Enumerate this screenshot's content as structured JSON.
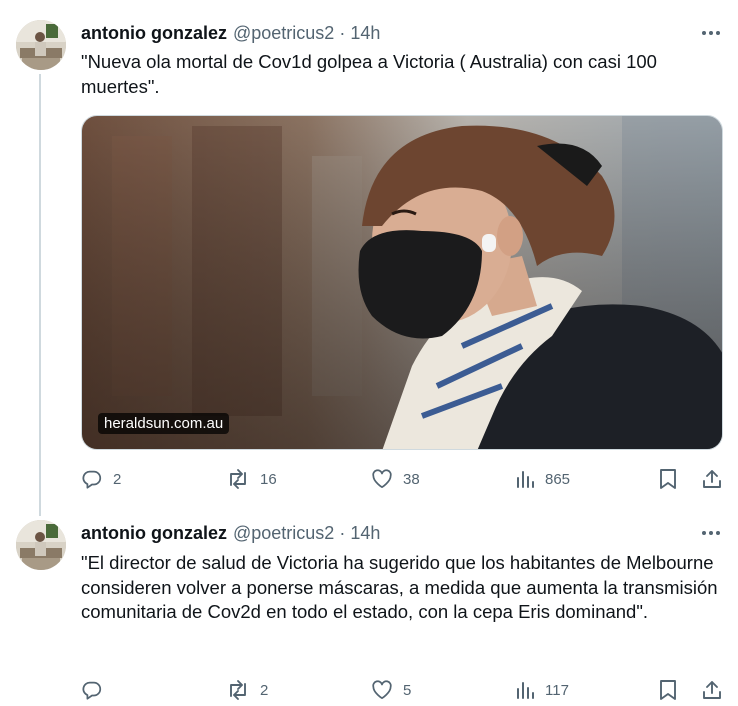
{
  "tweets": [
    {
      "author_name": "antonio gonzalez",
      "handle": "@poetricus2",
      "separator": "·",
      "time": "14h",
      "text": "\"Nueva ola mortal de Cov1d  golpea a Victoria ( Australia) con casi 100 muertes\".",
      "media": {
        "link_label": "heraldsun.com.au"
      },
      "stats": {
        "replies": "2",
        "reposts": "16",
        "likes": "38",
        "views": "865"
      }
    },
    {
      "author_name": "antonio gonzalez",
      "handle": "@poetricus2",
      "separator": "·",
      "time": "14h",
      "text": "\"El director de salud  de Victoria ha sugerido que los habitantes de Melbourne consideren volver a ponerse máscaras, a medida que aumenta la transmisión comunitaria de Cov2d en todo el estado, con la cepa Eris dominand\".",
      "stats": {
        "replies": "",
        "reposts": "2",
        "likes": "5",
        "views": "117"
      }
    }
  ],
  "icons": [
    "more-icon",
    "reply-icon",
    "repost-icon",
    "like-icon",
    "views-icon",
    "bookmark-icon",
    "share-icon"
  ],
  "colors": {
    "text": "#0f1419",
    "secondary": "#536471",
    "thread_line": "#cfd9de"
  }
}
